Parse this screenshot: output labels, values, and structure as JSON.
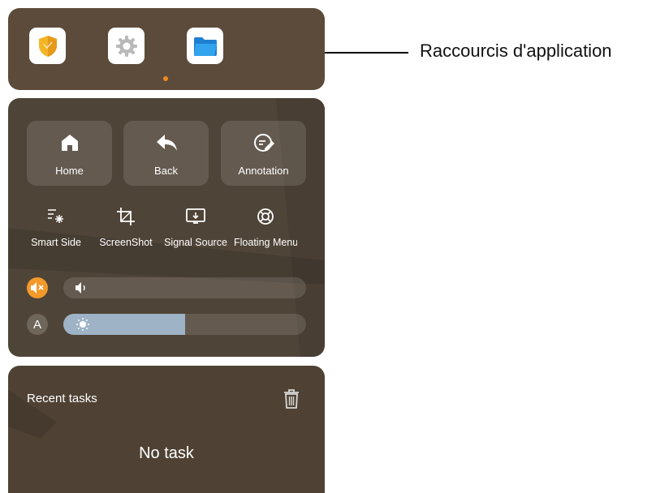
{
  "app_shortcuts": {
    "apps": [
      {
        "name": "security-shield-app",
        "icon": "shield-icon"
      },
      {
        "name": "settings-app",
        "icon": "gear-icon"
      },
      {
        "name": "file-manager-app",
        "icon": "folder-icon"
      }
    ],
    "page_indicator_color": "#f08a1c"
  },
  "quick_actions": [
    {
      "label": "Home",
      "icon": "home-icon"
    },
    {
      "label": "Back",
      "icon": "back-arrow-icon"
    },
    {
      "label": "Annotation",
      "icon": "annotation-pen-icon"
    }
  ],
  "tools": [
    {
      "label": "Smart Side",
      "icon": "smart-side-icon"
    },
    {
      "label": "ScreenShot",
      "icon": "crop-icon"
    },
    {
      "label": "Signal Source",
      "icon": "signal-source-icon"
    },
    {
      "label": "Floating Menu",
      "icon": "floating-menu-icon"
    }
  ],
  "volume": {
    "muted": true,
    "level": 0,
    "icon": "speaker-icon",
    "mute_icon": "speaker-muted-icon",
    "badge_color": "#f39a2b"
  },
  "brightness": {
    "auto_label": "A",
    "level": 0.5,
    "icon": "sun-icon",
    "fill_color": "#9fb3c6"
  },
  "recent_tasks": {
    "title": "Recent tasks",
    "empty_text": "No task",
    "clear_icon": "trash-icon"
  },
  "callout": {
    "label": "Raccourcis d'application"
  }
}
